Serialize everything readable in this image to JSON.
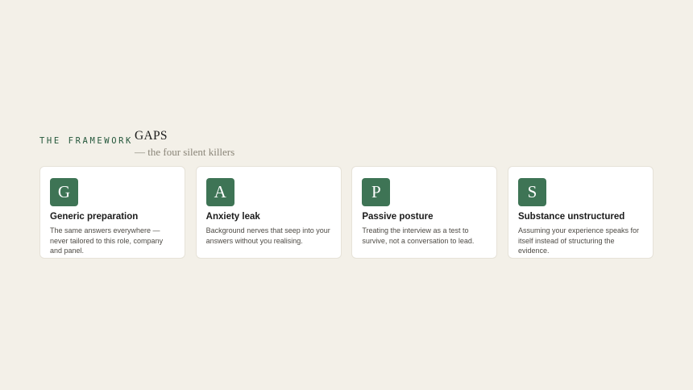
{
  "framework": {
    "eyebrow": "THE FRAMEWORK",
    "title": "GAPS",
    "subtitle": "— the four silent killers"
  },
  "cards": [
    {
      "letter": "G",
      "title": "Generic preparation",
      "description": "The same answers everywhere — never tailored to this role, company and panel."
    },
    {
      "letter": "A",
      "title": "Anxiety leak",
      "description": "Background nerves that seep into your answers without you realising."
    },
    {
      "letter": "P",
      "title": "Passive posture",
      "description": "Treating the interview as a test to survive, not a conversation to lead."
    },
    {
      "letter": "S",
      "title": "Substance unstructured",
      "description": "Assuming your experience speaks for itself instead of structuring the evidence."
    }
  ],
  "colors": {
    "background": "#f3f0e8",
    "accent": "#3e7455",
    "eyebrow": "#24573b"
  }
}
